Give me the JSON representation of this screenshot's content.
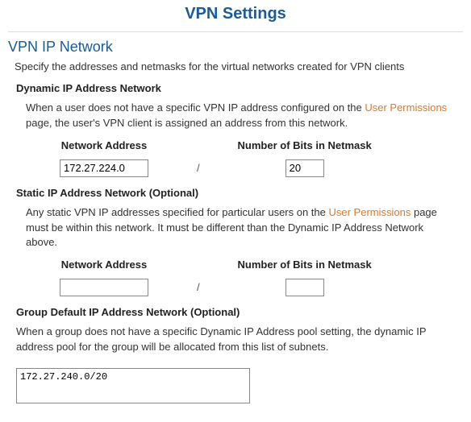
{
  "page": {
    "title": "VPN Settings"
  },
  "section": {
    "title": "VPN IP Network",
    "desc": "Specify the addresses and netmasks for the virtual networks created for VPN clients"
  },
  "dynamic": {
    "heading": "Dynamic IP Address Network",
    "desc_pre": "When a user does not have a specific VPN IP address configured on the ",
    "desc_link": "User Permissions",
    "desc_post": " page, the user's VPN client is assigned an address from this network.",
    "addr_label": "Network Address",
    "bits_label": "Number of Bits in Netmask",
    "addr_value": "172.27.224.0",
    "bits_value": "20",
    "slash": "/"
  },
  "static": {
    "heading": "Static IP Address Network (Optional)",
    "desc_pre": "Any static VPN IP addresses specified for particular users on the ",
    "desc_link": "User Permissions",
    "desc_post": " page must be within this network. It must be different than the Dynamic IP Address Network above.",
    "addr_label": "Network Address",
    "bits_label": "Number of Bits in Netmask",
    "addr_value": "",
    "bits_value": "",
    "slash": "/"
  },
  "group": {
    "heading": "Group Default IP Address Network (Optional)",
    "desc": "When a group does not have a specific Dynamic IP Address pool setting, the dynamic IP address pool for the group will be allocated from this list of subnets.",
    "subnets_value": "172.27.240.0/20"
  }
}
